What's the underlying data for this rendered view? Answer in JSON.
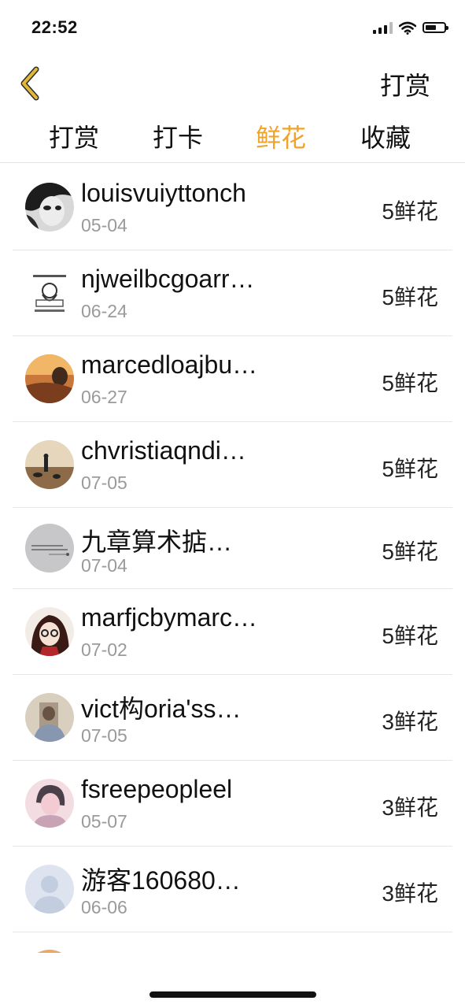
{
  "status_bar": {
    "time": "22:52",
    "icons": [
      "signal-icon",
      "wifi-icon",
      "battery-icon"
    ],
    "battery_level": 0.6
  },
  "nav": {
    "back_icon": "chevron-left-icon",
    "back_color": "#e0b83a",
    "action_label": "打赏"
  },
  "tabs": [
    {
      "label": "打赏",
      "active": false
    },
    {
      "label": "打卡",
      "active": false
    },
    {
      "label": "鲜花",
      "active": true
    },
    {
      "label": "收藏",
      "active": false
    }
  ],
  "accent_color": "#f0a32a",
  "rows": [
    {
      "name": "louisvuiyttonch",
      "date": "05-04",
      "amount": "5鲜花",
      "avatar": "avatar-dark-portrait"
    },
    {
      "name": "njweilbcgoarr…",
      "date": "06-24",
      "amount": "5鲜花",
      "avatar": "avatar-cartoon-sketch"
    },
    {
      "name": "marcedloajbu…",
      "date": "06-27",
      "amount": "5鲜花",
      "avatar": "avatar-sunset"
    },
    {
      "name": "chvristiaqndi…",
      "date": "07-05",
      "amount": "5鲜花",
      "avatar": "avatar-beach-silhouette"
    },
    {
      "name": "九章算术掂…",
      "date": "07-04",
      "amount": "5鲜花",
      "avatar": "avatar-gray-text"
    },
    {
      "name": "marfjcbymarc…",
      "date": "07-02",
      "amount": "5鲜花",
      "avatar": "avatar-girl-glasses"
    },
    {
      "name": "vict构oria'ss…",
      "date": "07-05",
      "amount": "3鲜花",
      "avatar": "avatar-mirror-selfie"
    },
    {
      "name": "fsreepeopleel",
      "date": "05-07",
      "amount": "3鲜花",
      "avatar": "avatar-pink-portrait"
    },
    {
      "name": "游客160680…",
      "date": "06-06",
      "amount": "3鲜花",
      "avatar": "avatar-default-user"
    }
  ]
}
